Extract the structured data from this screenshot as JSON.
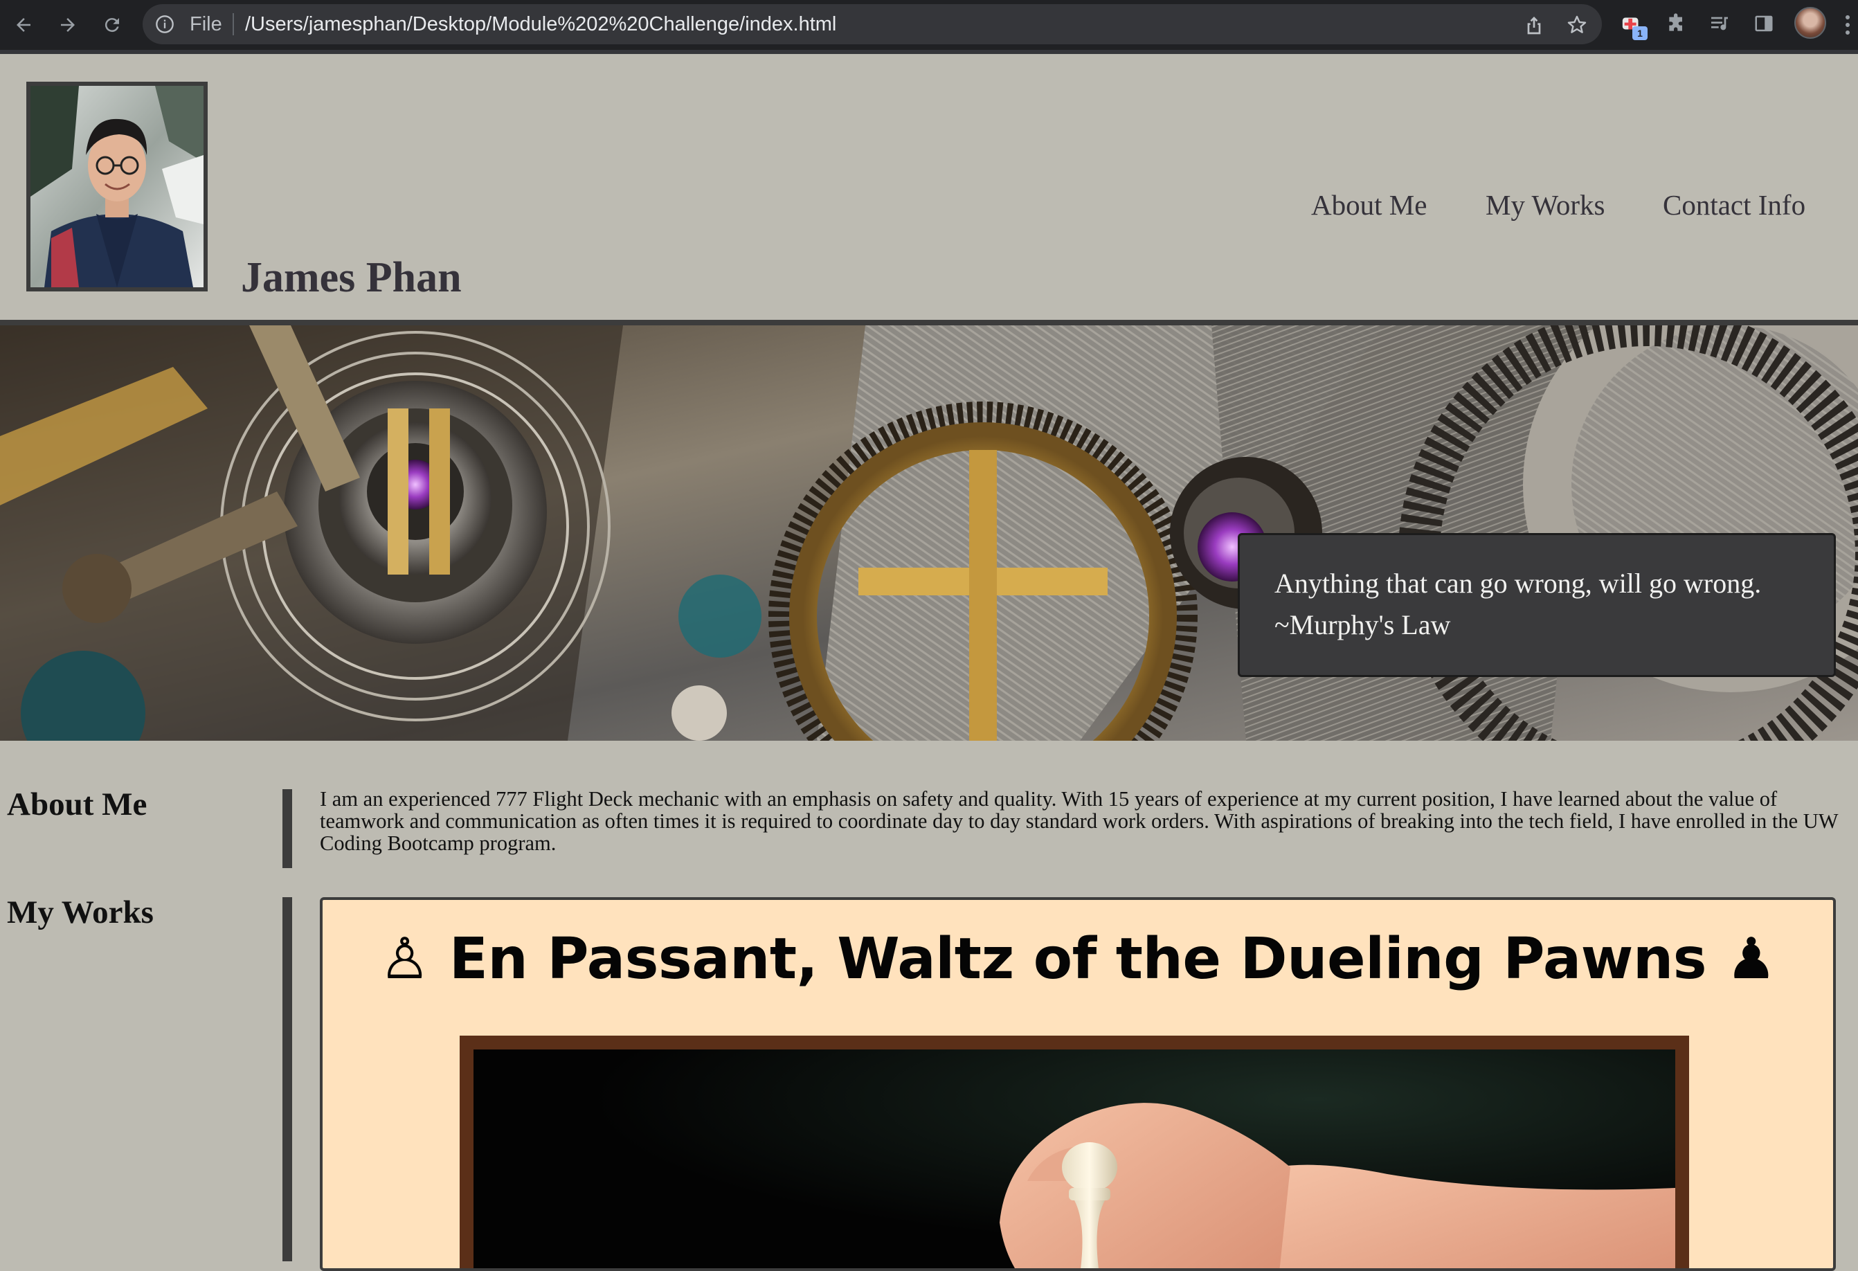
{
  "browser": {
    "file_label": "File",
    "url": "/Users/jamesphan/Desktop/Module%202%20Challenge/index.html",
    "extension_badge": "1"
  },
  "header": {
    "name": "James Phan",
    "nav": [
      "About Me",
      "My Works",
      "Contact Info"
    ]
  },
  "hero": {
    "quote_line1": "Anything that can go wrong, will go wrong.",
    "quote_line2": "~Murphy's Law"
  },
  "about": {
    "heading": "About Me",
    "text": "I am an experienced 777 Flight Deck mechanic with an emphasis on safety and quality. With 15 years of experience at my current position, I have learned about the value of teamwork and communication as often times it is required to coordinate day to day standard work orders. With aspirations of breaking into the tech field, I have enrolled in the UW Coding Bootcamp program."
  },
  "works": {
    "heading": "My Works",
    "project_title": "♙ En Passant, Waltz of the Dueling Pawns ♟"
  },
  "colors": {
    "page_bg": "#bdbbb2",
    "dark_accent": "#3c3c3c",
    "card_bg": "#ffe2bd",
    "image_frame": "#5b2f18"
  }
}
